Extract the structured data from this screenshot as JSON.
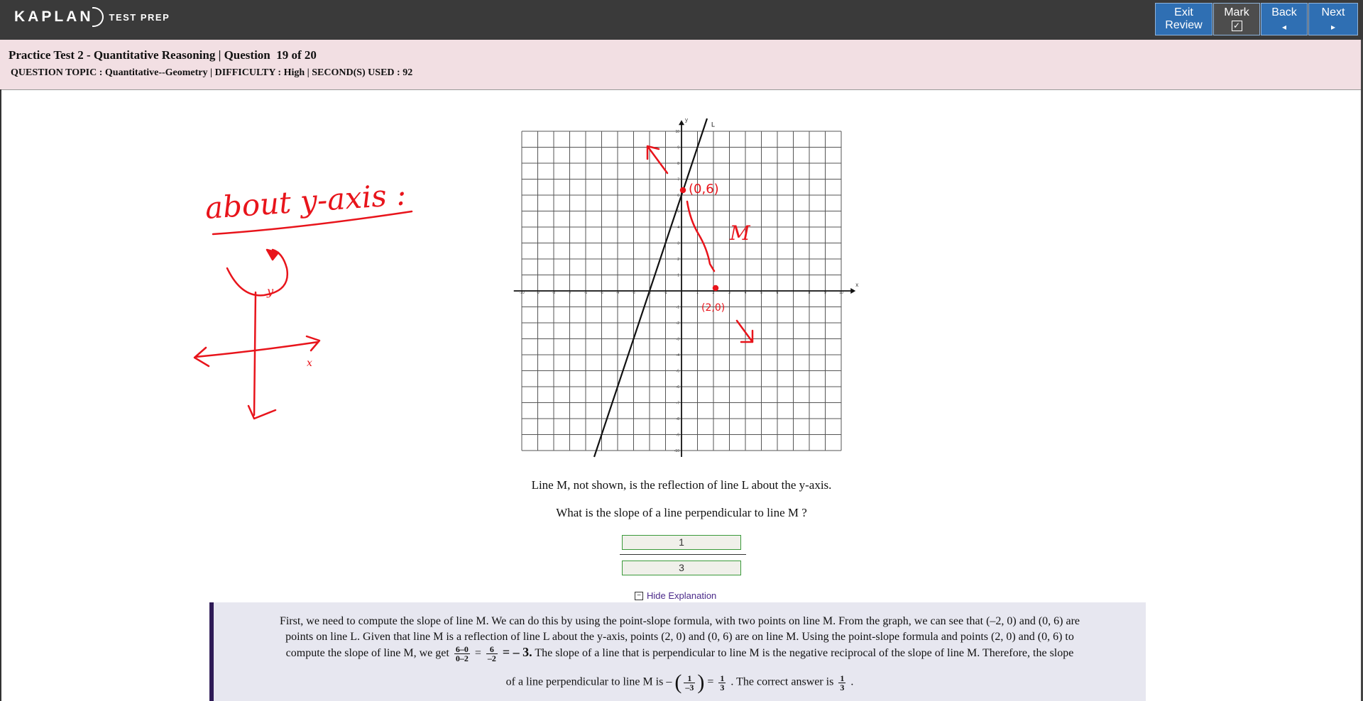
{
  "brand": {
    "name": "KAPLAN",
    "sub": "TEST PREP"
  },
  "nav": {
    "exit_line1": "Exit",
    "exit_line2": "Review",
    "mark": "Mark",
    "mark_check": "✓",
    "back": "Back",
    "back_arrow": "◂",
    "next": "Next",
    "next_arrow": "▸"
  },
  "header": {
    "title": "Practice Test 2 - Quantitative Reasoning | Question  19 of 20",
    "topic": "QUESTION TOPIC : Quantitative--Geometry | DIFFICULTY : High | SECOND(S) USED : 92"
  },
  "graph": {
    "x_axis_label": "x",
    "y_axis_label": "y",
    "line_label": "L",
    "x_ticks": [
      "-10",
      "-9",
      "-8",
      "-7",
      "-6",
      "-5",
      "-4",
      "-3",
      "-2",
      "-1",
      "1",
      "2",
      "3",
      "4",
      "5",
      "6",
      "7",
      "8",
      "9",
      "10"
    ],
    "y_ticks": [
      "10",
      "9",
      "8",
      "7",
      "6",
      "5",
      "4",
      "3",
      "2",
      "1",
      "-1",
      "-2",
      "-3",
      "-4",
      "-5",
      "-6",
      "-7",
      "-8",
      "-9",
      "-10"
    ],
    "line_L_points": [
      [
        -2,
        0
      ],
      [
        0,
        6
      ]
    ]
  },
  "handwriting": {
    "about_y_axis": "about y-axis :",
    "point_0_6": "(0,6)",
    "point_2_0": "(2,0)",
    "label_M": "M",
    "axis_y": "y",
    "axis_x": "x"
  },
  "question": {
    "statement": "Line M, not shown, is the reflection of line L about the y-axis.",
    "prompt": "What is the slope of a line perpendicular to line M ?",
    "answer_numerator": "1",
    "answer_denominator": "3"
  },
  "explanation": {
    "toggle": "Hide Explanation",
    "line1": "First, we need to compute the slope of line M. We can do this by using the point-slope formula, with two points on line M. From the graph, we can see that (–2, 0) and (0, 6) are",
    "line2": "points on line L. Given that line M is a reflection of line L about the y-axis, points (2, 0) and (0, 6) are on line M. Using the point-slope formula and points (2, 0) and (0, 6) to",
    "line3_a": "compute the slope of line M, we get",
    "line3_f1_num": "6–0",
    "line3_f1_den": "0–2",
    "line3_eq": "=",
    "line3_f2_num": "6",
    "line3_f2_den": "–2",
    "line3_result": "= – 3.",
    "line3_b": "The slope of a line that is perpendicular to line M is the negative reciprocal of the slope of line M. Therefore, the slope",
    "line4_a": "of a line perpendicular to line M is –",
    "line4_f1_num": "1",
    "line4_f1_den": "–3",
    "line4_eq": "=",
    "line4_f2_num": "1",
    "line4_f2_den": "3",
    "line4_b": ". The correct answer is",
    "line4_f3_num": "1",
    "line4_f3_den": "3",
    "line4_end": "."
  },
  "colors": {
    "topbar": "#3a3a3a",
    "nav_button": "#2f6fb3",
    "header_bg": "#f2dfe3",
    "explanation_bg": "#e7e7f0",
    "ink": "#e8141b"
  }
}
